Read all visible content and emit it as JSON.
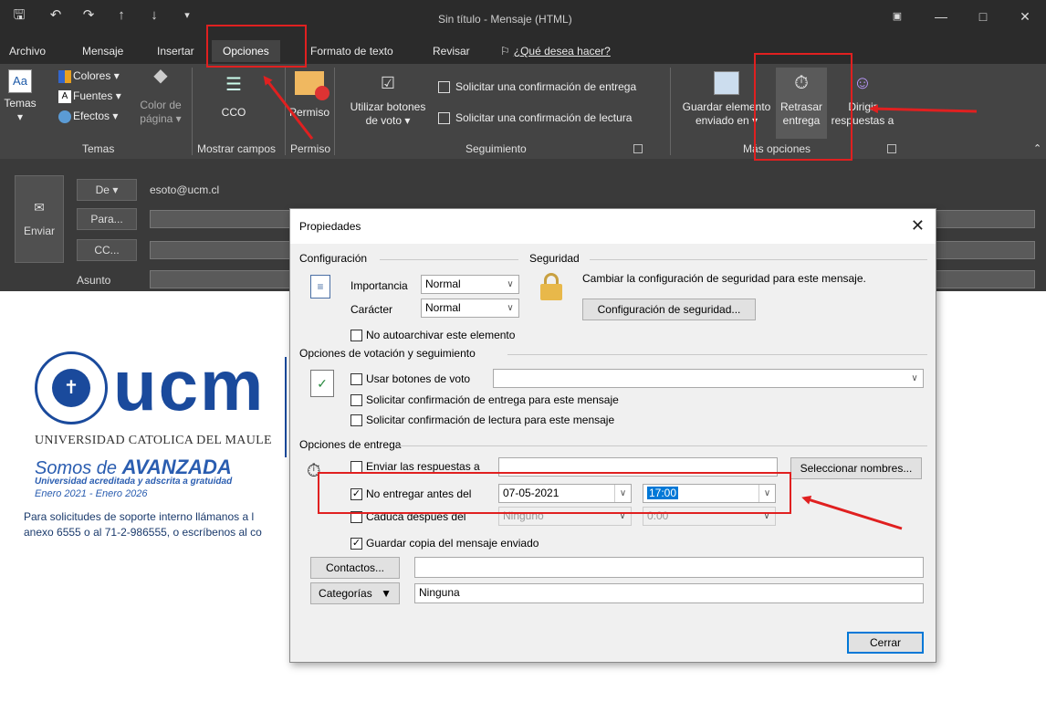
{
  "window": {
    "title": "Sin título - Mensaje (HTML)"
  },
  "menu": {
    "tabs": [
      "Archivo",
      "Mensaje",
      "Insertar",
      "Opciones",
      "Formato de texto",
      "Revisar"
    ],
    "tell_me": "¿Qué desea hacer?",
    "active_tab": "Opciones"
  },
  "ribbon": {
    "temas": "Temas",
    "colores": "Colores",
    "fuentes": "Fuentes",
    "efectos": "Efectos",
    "color_pagina_1": "Color de",
    "color_pagina_2": "página",
    "cco": "CCO",
    "permiso": "Permiso",
    "utilizar_1": "Utilizar botones",
    "utilizar_2": "de voto",
    "solicitar_entrega": "Solicitar una confirmación de entrega",
    "solicitar_lectura": "Solicitar una confirmación de lectura",
    "guardar_1": "Guardar elemento",
    "guardar_2": "enviado en",
    "retrasar_1": "Retrasar",
    "retrasar_2": "entrega",
    "dirigir_1": "Dirigir",
    "dirigir_2": "respuestas a",
    "groups": {
      "temas": "Temas",
      "mostrar_campos": "Mostrar campos",
      "permiso": "Permiso",
      "seguimiento": "Seguimiento",
      "mas_opciones": "Más opciones"
    }
  },
  "compose": {
    "from_label": "De",
    "from_value": "esoto@ucm.cl",
    "to_label": "Para...",
    "cc_label": "CC...",
    "subject_label": "Asunto",
    "send_label": "Enviar"
  },
  "signature": {
    "university": "UNIVERSIDAD CATOLICA DEL MAULE",
    "logo_text": "ucm",
    "slogan_1": "Somos de",
    "slogan_2": "AVANZADA",
    "slogan_sub": "Universidad acreditada y adscrita a gratuidad",
    "slogan_years": "Enero 2021 - Enero 2026",
    "support_1": "Para solicitudes de soporte interno llámanos a l",
    "support_2": "anexo 6555 o al 71-2-986555, o escríbenos al co"
  },
  "dialog": {
    "title": "Propiedades",
    "configuracion": "Configuración",
    "seguridad": "Seguridad",
    "importancia_label": "Importancia",
    "importancia_value": "Normal",
    "caracter_label": "Carácter",
    "caracter_value": "Normal",
    "seguridad_text": "Cambiar la configuración de seguridad para este mensaje.",
    "config_seguridad_btn": "Configuración de seguridad...",
    "no_autoarchivar": "No autoarchivar este elemento",
    "votacion_section": "Opciones de votación y seguimiento",
    "usar_botones": "Usar botones de voto",
    "solicitar_entrega": "Solicitar confirmación de entrega para este mensaje",
    "solicitar_lectura": "Solicitar confirmación de lectura para este mensaje",
    "entrega_section": "Opciones de entrega",
    "enviar_respuestas": "Enviar las respuestas a",
    "seleccionar_nombres": "Seleccionar nombres...",
    "no_entregar": "No entregar antes del",
    "no_entregar_date": "07-05-2021",
    "no_entregar_time": "17:00",
    "caduca": "Caduca después del",
    "caduca_date": "Ninguno",
    "caduca_time": "0:00",
    "guardar_copia": "Guardar copia del mensaje enviado",
    "contactos_btn": "Contactos...",
    "categorias_btn": "Categorías",
    "categorias_value": "Ninguna",
    "cerrar_btn": "Cerrar"
  },
  "colors": {
    "annotation": "#e02020",
    "ucm_blue": "#1a4a9c",
    "slogan_blue": "#2a5db0"
  }
}
